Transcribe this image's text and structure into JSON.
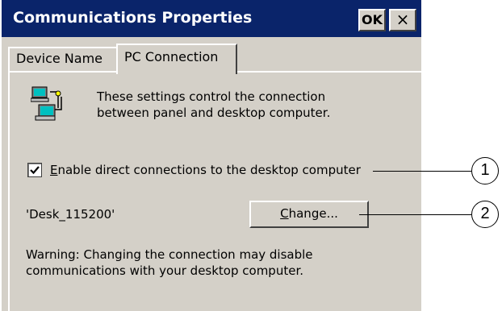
{
  "window": {
    "title": "Communications Properties",
    "ok_label": "OK",
    "close_symbol": "×"
  },
  "tabs": [
    {
      "label": "Device Name"
    },
    {
      "label": "PC Connection"
    }
  ],
  "info_text_line1": "These settings control the connection",
  "info_text_line2": "between panel and desktop computer.",
  "checkbox": {
    "checked": true,
    "label_first": "E",
    "label_rest": "nable direct connections to the desktop computer"
  },
  "device_name": "'Desk_115200'",
  "change_button": {
    "label_first": "C",
    "label_rest": "hange..."
  },
  "warning_line1": "Warning: Changing the connection may disable",
  "warning_line2": "communications with your desktop computer.",
  "callouts": [
    "1",
    "2"
  ],
  "icons": {
    "pc_connection": "pc-connection-icon",
    "check": "checkmark-icon"
  }
}
